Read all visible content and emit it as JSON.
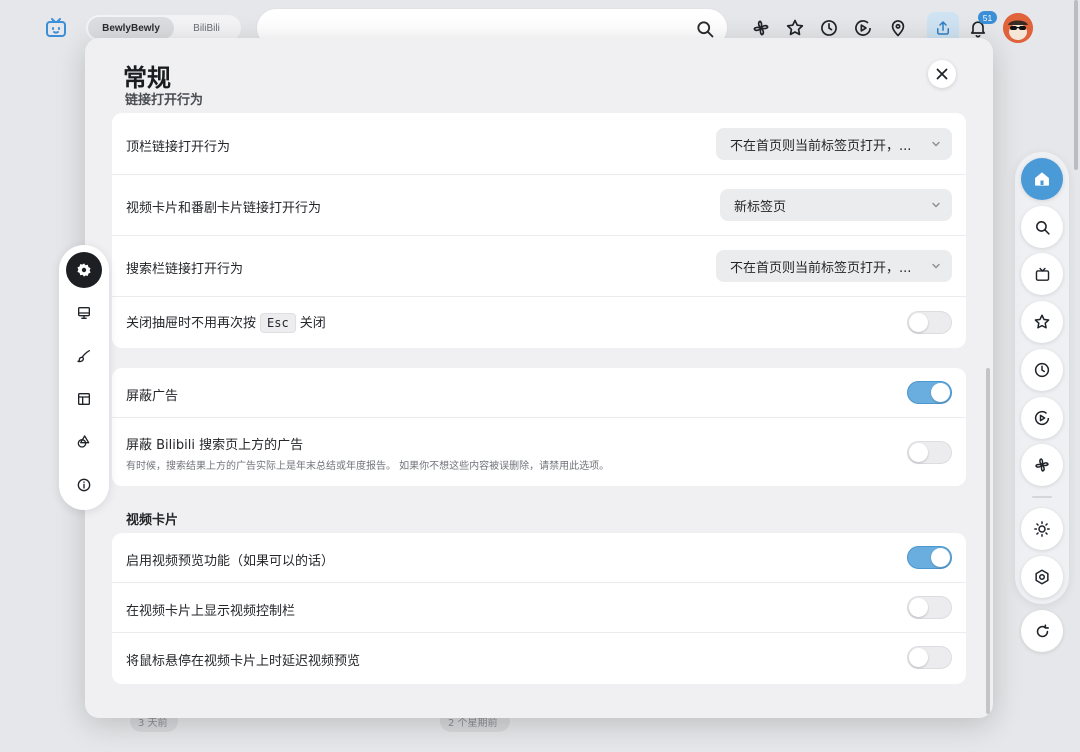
{
  "header": {
    "tabs": [
      {
        "label": "BewlyBewly",
        "active": true
      },
      {
        "label": "BiliBili",
        "active": false
      }
    ],
    "search_placeholder": "",
    "icons": [
      "pinwheel-icon",
      "star-icon",
      "clock-icon",
      "play-circle-icon",
      "location-icon",
      "upload-icon",
      "bell-icon"
    ],
    "notification_count": "51",
    "accent_color": "#3b8fd6"
  },
  "background_cards": [
    {
      "label": "3 天前"
    },
    {
      "label": "2 个星期前"
    }
  ],
  "settings": {
    "title": "常规",
    "section_link_behavior": "链接打开行为",
    "link_rows": [
      {
        "label": "顶栏链接打开行为",
        "value": "不在首页则当前标签页打开，..."
      },
      {
        "label": "视频卡片和番剧卡片链接打开行为",
        "value": "新标签页"
      },
      {
        "label": "搜索栏链接打开行为",
        "value": "不在首页则当前标签页打开，..."
      }
    ],
    "esc_row": {
      "prefix": "关闭抽屉时不用再次按",
      "key": "Esc",
      "suffix": "关闭",
      "enabled": false
    },
    "ads": [
      {
        "label": "屏蔽广告",
        "enabled": true
      },
      {
        "label": "屏蔽 Bilibili 搜索页上方的广告",
        "desc": "有时候，搜索结果上方的广告实际上是年末总结或年度报告。 如果你不想这些内容被误删除，请禁用此选项。",
        "enabled": false
      }
    ],
    "section_video_card": "视频卡片",
    "video_card_rows": [
      {
        "label": "启用视频预览功能（如果可以的话）",
        "enabled": true
      },
      {
        "label": "在视频卡片上显示视频控制栏",
        "enabled": false
      },
      {
        "label": "将鼠标悬停在视频卡片上时延迟视频预览",
        "enabled": false
      }
    ]
  },
  "left_nav": [
    "general-icon",
    "desktop-icon",
    "brush-icon",
    "layout-icon",
    "shapes-icon",
    "info-icon"
  ],
  "right_dock": [
    "home-icon",
    "search-icon",
    "tv-icon",
    "star-icon",
    "clock-icon",
    "play-circle-icon",
    "pinwheel-icon",
    "theme-icon",
    "settings-icon",
    "refresh-icon"
  ]
}
